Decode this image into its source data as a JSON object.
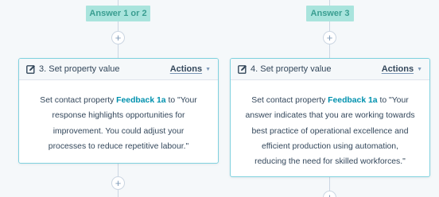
{
  "branches": [
    {
      "answer_label": "Answer 1 or 2",
      "card": {
        "title": "3. Set property value",
        "actions_label": "Actions",
        "body_prefix": "Set contact property ",
        "property_name": "Feedback 1a",
        "body_to": " to ",
        "value_text": "\"Your response highlights opportunities for improvement. You could adjust your processes to reduce repetitive labour.\""
      }
    },
    {
      "answer_label": "Answer 3",
      "card": {
        "title": "4. Set property value",
        "actions_label": "Actions",
        "body_prefix": "Set contact property ",
        "property_name": "Feedback 1a",
        "body_to": " to ",
        "value_text": "\"Your answer indicates that you are working towards best practice of operational excellence and efficient production using automation, reducing the need for skilled workforces.\""
      }
    }
  ],
  "add_action_symbol": "+",
  "icons": {
    "card_header": "edit-pencil-icon",
    "actions_caret": "caret-down-icon",
    "add_action": "plus-icon"
  },
  "colors": {
    "background": "#f5f8fa",
    "answer_badge_bg": "#a9e4dd",
    "answer_badge_text": "#3a9e91",
    "card_border": "#7fd1de",
    "link": "#0091ae",
    "text": "#33475b"
  }
}
